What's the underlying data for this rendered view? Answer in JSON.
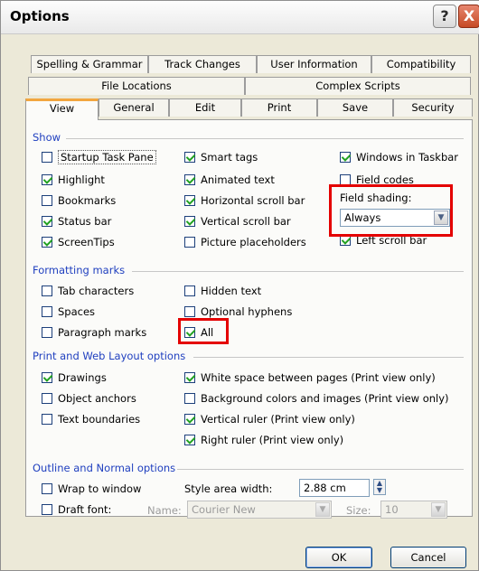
{
  "window": {
    "title": "Options",
    "help_glyph": "?",
    "close_glyph": "X"
  },
  "tabs_row1": [
    "Spelling & Grammar",
    "Track Changes",
    "User Information",
    "Compatibility"
  ],
  "tabs_row2": [
    "File Locations",
    "Complex Scripts"
  ],
  "tabs_row3": [
    "View",
    "General",
    "Edit",
    "Print",
    "Save",
    "Security"
  ],
  "active_tab": "View",
  "show": {
    "heading": "Show",
    "startup_task_pane": "Startup Task Pane",
    "highlight": "Highlight",
    "bookmarks": "Bookmarks",
    "status_bar": "Status bar",
    "screentips": "ScreenTips",
    "smart_tags": "Smart tags",
    "animated_text": "Animated text",
    "horizontal_scroll_bar": "Horizontal scroll bar",
    "vertical_scroll_bar": "Vertical scroll bar",
    "picture_placeholders": "Picture placeholders",
    "windows_in_taskbar": "Windows in Taskbar",
    "field_codes": "Field codes",
    "field_shading_label": "Field shading:",
    "field_shading_value": "Always",
    "left_scroll_bar": "Left scroll bar"
  },
  "formatting": {
    "heading": "Formatting marks",
    "tab_characters": "Tab characters",
    "spaces": "Spaces",
    "paragraph_marks": "Paragraph marks",
    "hidden_text": "Hidden text",
    "optional_hyphens": "Optional hyphens",
    "all": "All"
  },
  "print_layout": {
    "heading": "Print and Web Layout options",
    "drawings": "Drawings",
    "object_anchors": "Object anchors",
    "text_boundaries": "Text boundaries",
    "white_space": "White space between pages (Print view only)",
    "background_colors": "Background colors and images (Print view only)",
    "vertical_ruler": "Vertical ruler (Print view only)",
    "right_ruler": "Right ruler (Print view only)"
  },
  "outline": {
    "heading": "Outline and Normal options",
    "wrap_to_window": "Wrap to window",
    "draft_font": "Draft font:",
    "style_area_label": "Style area width:",
    "style_area_value": "2.88 cm",
    "name_label": "Name:",
    "name_value": "Courier New",
    "size_label": "Size:",
    "size_value": "10"
  },
  "buttons": {
    "ok": "OK",
    "cancel": "Cancel"
  }
}
